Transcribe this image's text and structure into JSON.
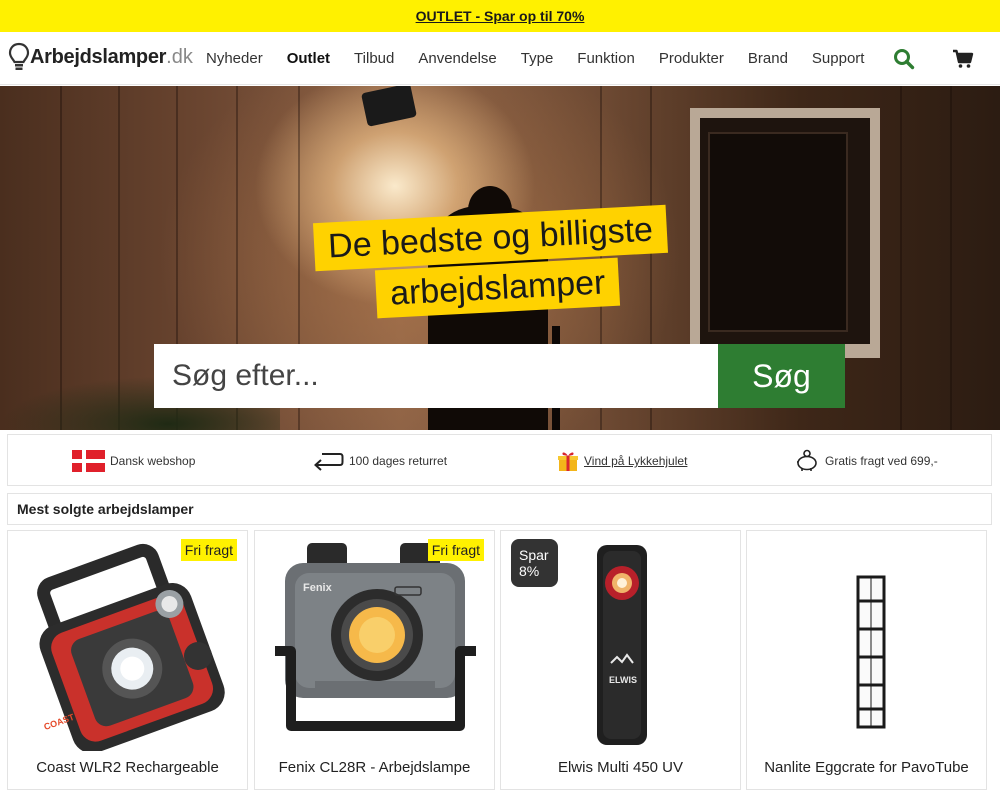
{
  "topbar": {
    "promo": "OUTLET - Spar op til 70%"
  },
  "header": {
    "logo_main": "Arbejdslamper",
    "logo_suffix": ".dk",
    "menu": [
      "Nyheder",
      "Outlet",
      "Tilbud",
      "Anvendelse",
      "Type",
      "Funktion",
      "Produkter",
      "Brand",
      "Support"
    ],
    "active_menu": "Outlet",
    "icons": [
      "search-icon",
      "cart-icon"
    ]
  },
  "hero": {
    "line1": "De bedste og billigste",
    "line2": "arbejdslamper",
    "search_placeholder": "Søg efter...",
    "search_button": "Søg"
  },
  "usps": [
    {
      "icon": "danish-flag-icon",
      "text": "Dansk webshop"
    },
    {
      "icon": "return-arrow-icon",
      "text": "100 dages returret"
    },
    {
      "icon": "gift-icon",
      "text": "Vind på Lykkehjulet"
    },
    {
      "icon": "piggy-bank-icon",
      "text": "Gratis fragt ved 699,-"
    }
  ],
  "section": {
    "title": "Mest solgte arbejdslamper"
  },
  "products": [
    {
      "title": "Coast WLR2 Rechargeable",
      "badge": "Fri fragt"
    },
    {
      "title": "Fenix CL28R - Arbejdslampe",
      "badge": "Fri fragt"
    },
    {
      "title": "Elwis Multi 450 UV",
      "badge": "Spar 8%"
    },
    {
      "title": "Nanlite Eggcrate for PavoTube",
      "badge": ""
    }
  ],
  "product_labels": {
    "coast_logo": "COAST",
    "fenix_logo": "Fenix",
    "elwis_logo": "ELWIS"
  },
  "colors": {
    "promo_yellow": "#fff100",
    "headline_yellow": "#ffd200",
    "search_green": "#2e7d32",
    "accent_green": "#2e7d32"
  }
}
